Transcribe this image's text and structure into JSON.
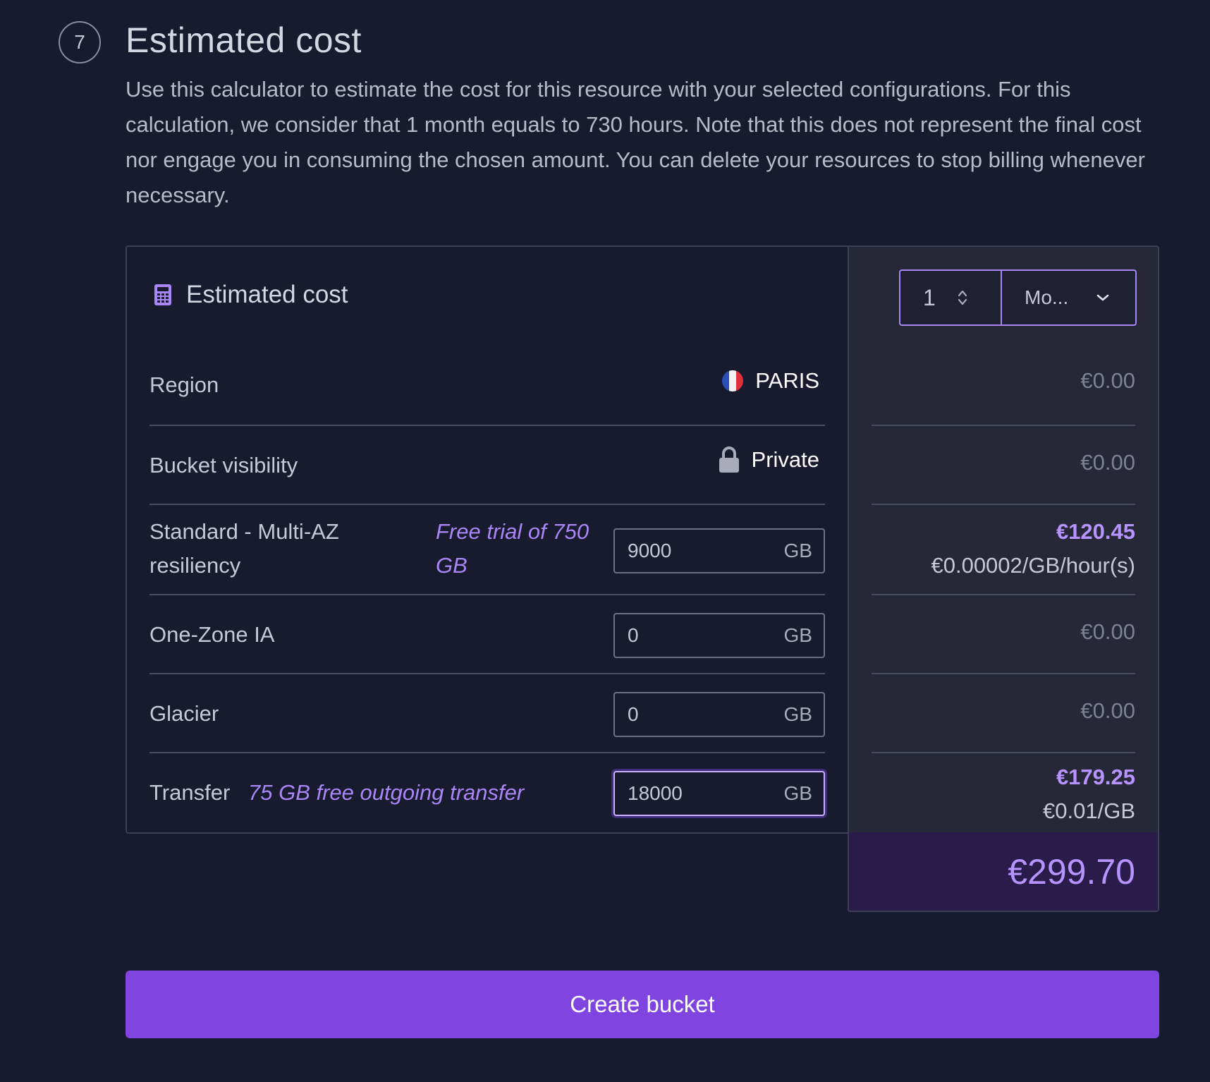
{
  "section": {
    "step_number": "7",
    "title": "Estimated cost",
    "description": "Use this calculator to estimate the cost for this resource with your selected configurations. For this calculation, we consider that 1 month equals to 730 hours. Note that this does not represent the final cost nor engage you in consuming the chosen amount. You can delete your resources to stop billing whenever necessary."
  },
  "calculator": {
    "title": "Estimated cost",
    "icon": "calculator-icon",
    "period": {
      "quantity": "1",
      "unit": "Mo..."
    },
    "rows": {
      "region": {
        "label": "Region",
        "value": "PARIS",
        "icon": "france-flag-icon",
        "price": "€0.00"
      },
      "visibility": {
        "label": "Bucket visibility",
        "value": "Private",
        "icon": "lock-icon",
        "price": "€0.00"
      },
      "standard": {
        "label_line1": "Standard - Multi-AZ",
        "label_line2": "resiliency",
        "note_line1": "Free trial of 750",
        "note_line2": "GB",
        "input_value": "9000",
        "input_unit": "GB",
        "price": "€120.45",
        "unit_price": "€0.00002/GB/hour(s)"
      },
      "onezone": {
        "label": "One-Zone IA",
        "input_value": "0",
        "input_unit": "GB",
        "price": "€0.00"
      },
      "glacier": {
        "label": "Glacier",
        "input_value": "0",
        "input_unit": "GB",
        "price": "€0.00"
      },
      "transfer": {
        "label": "Transfer",
        "note": "75 GB free outgoing transfer",
        "input_value": "18000",
        "input_unit": "GB",
        "price": "€179.25",
        "unit_price": "€0.01/GB"
      }
    },
    "total": "€299.70"
  },
  "actions": {
    "create_label": "Create bucket"
  },
  "colors": {
    "background": "#181a2e",
    "accent": "#8044e0",
    "accent_text": "#b693ff",
    "total_bg": "#291c4a"
  }
}
